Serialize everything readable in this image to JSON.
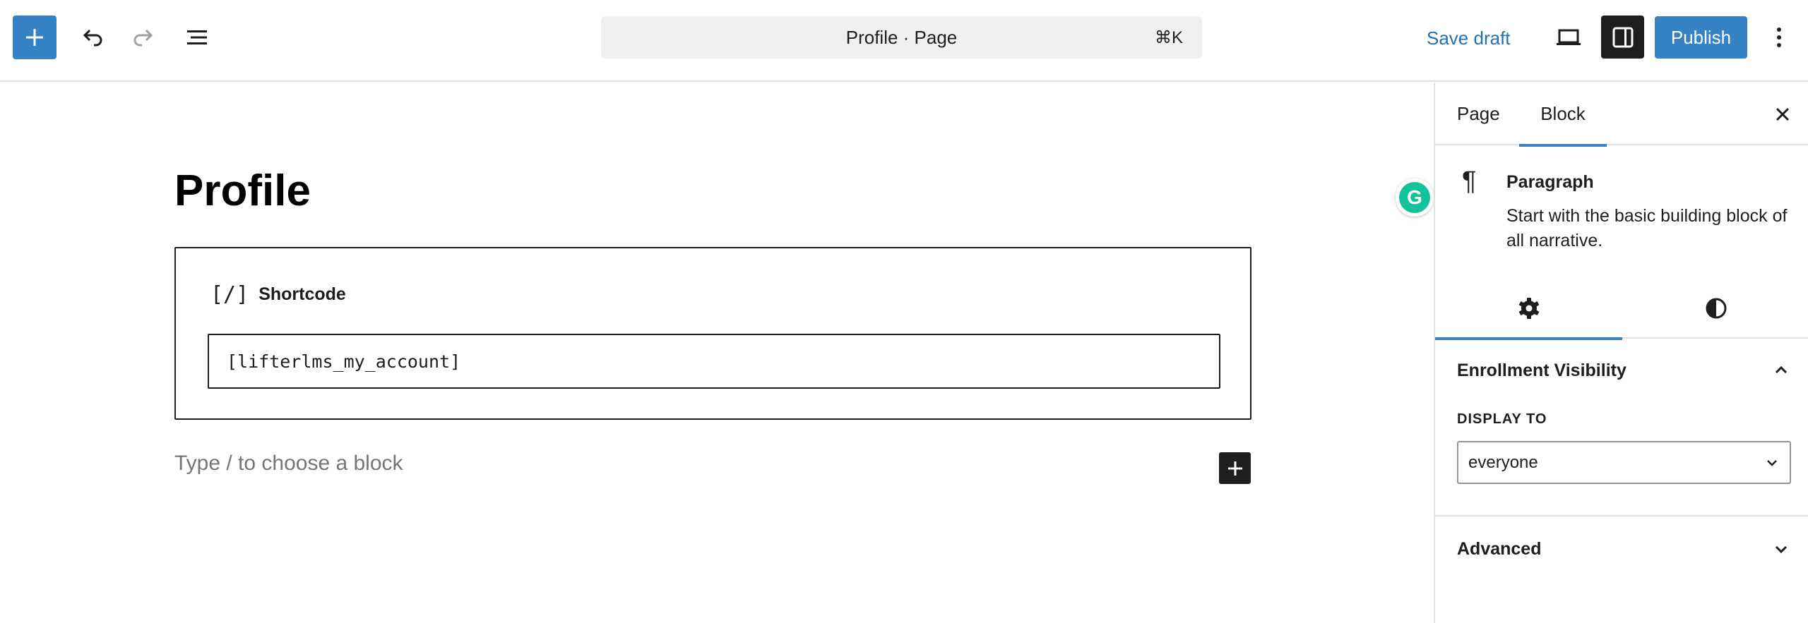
{
  "toolbar": {
    "add_block_icon": "plus-icon",
    "undo_icon": "undo-icon",
    "redo_icon": "redo-icon",
    "list_view_icon": "list-view-icon",
    "command_title": "Profile · Page",
    "command_shortcut": "⌘K",
    "save_draft_label": "Save draft",
    "preview_icon": "laptop-icon",
    "settings_icon": "sidebar-toggle-icon",
    "publish_label": "Publish",
    "options_icon": "more-vertical-icon"
  },
  "editor": {
    "post_title": "Profile",
    "shortcode_block": {
      "icon": "[/]",
      "label": "Shortcode",
      "value": "[lifterlms_my_account]"
    },
    "appender_placeholder": "Type / to choose a block"
  },
  "grammarly": {
    "letter": "G"
  },
  "sidebar": {
    "tabs": [
      {
        "label": "Page"
      },
      {
        "label": "Block"
      }
    ],
    "block_card": {
      "icon": "¶",
      "title": "Paragraph",
      "description": "Start with the basic building block of all narrative."
    },
    "enrollment_panel": {
      "title": "Enrollment Visibility",
      "display_label": "DISPLAY TO",
      "display_value": "everyone"
    },
    "advanced_panel": {
      "title": "Advanced"
    }
  },
  "colors": {
    "accent": "#3582c4",
    "dark": "#1e1e1e",
    "link": "#2271b1",
    "placeholder": "#757575"
  }
}
